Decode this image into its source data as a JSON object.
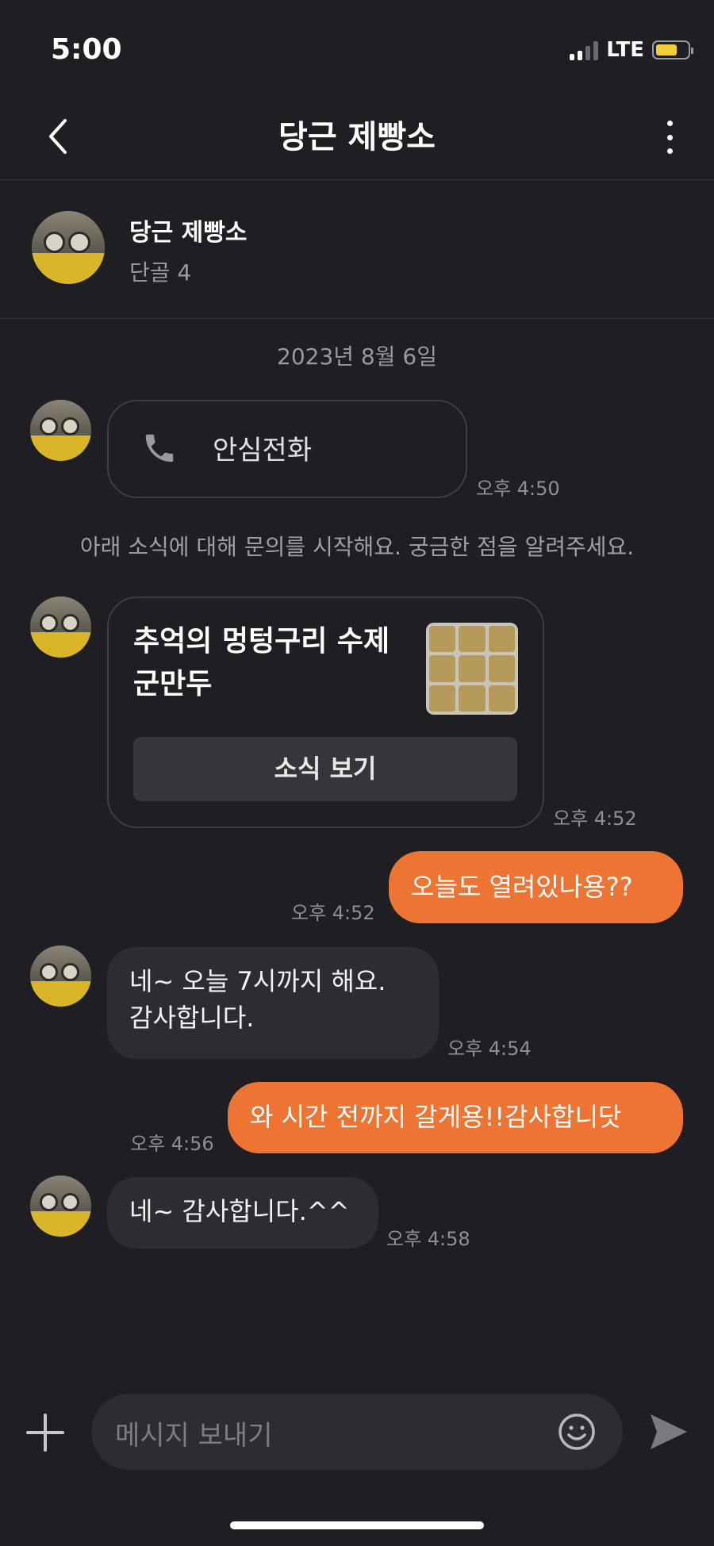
{
  "status_bar": {
    "time": "5:00",
    "network": "LTE"
  },
  "header": {
    "title": "당근 제빵소"
  },
  "profile": {
    "name": "당근 제빵소",
    "subtitle": "단골 4"
  },
  "date_separator": "2023년 8월 6일",
  "call_message": {
    "label": "안심전화",
    "time": "오후 4:50"
  },
  "notice": "아래 소식에 대해 문의를 시작해요. 궁금한 점을 알려주세요.",
  "card": {
    "title_line1": "추억의 멍텅구리 수제",
    "title_line2": "군만두",
    "button_label": "소식 보기",
    "time": "오후 4:52"
  },
  "messages": [
    {
      "side": "out",
      "text": "오늘도 열려있나용??",
      "time": "오후 4:52"
    },
    {
      "side": "in",
      "text_line1": "네~ 오늘 7시까지 해요.",
      "text_line2": "감사합니다.",
      "time": "오후 4:54"
    },
    {
      "side": "out",
      "text": "와 시간 전까지 갈게용!!감사합니닷",
      "time": "오후 4:56"
    },
    {
      "side": "in",
      "text": "네~ 감사합니다.^^",
      "time": "오후 4:58"
    }
  ],
  "composer": {
    "placeholder": "메시지 보내기"
  },
  "colors": {
    "background": "#1f1f23",
    "accent": "#ee7433",
    "bubble_in": "#2c2d31"
  },
  "icons": [
    "back-icon",
    "more-icon",
    "phone-icon",
    "plus-icon",
    "emoji-icon",
    "send-icon"
  ]
}
